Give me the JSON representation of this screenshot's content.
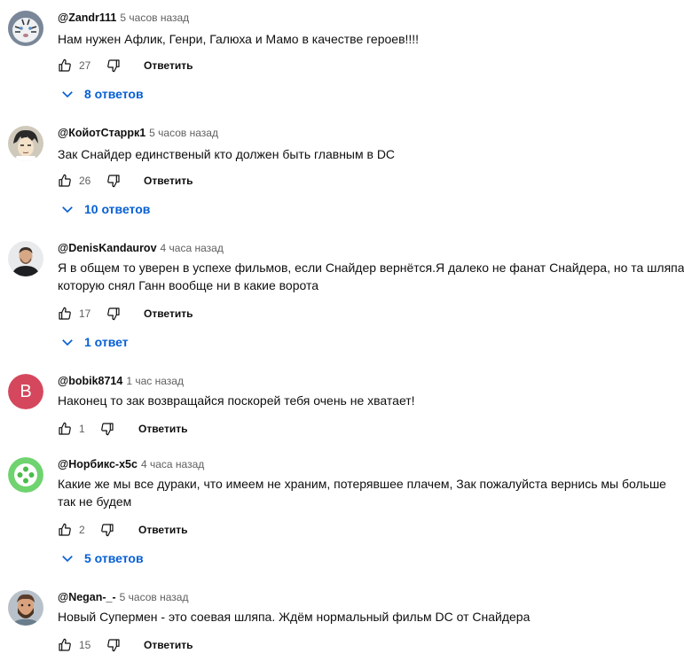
{
  "comments": [
    {
      "author": "@Zandr111",
      "time": "5 часов назад",
      "text_lines": [
        "Нам нужен Афлик, Генри, Галюха и Мамо в качестве героев!!!!"
      ],
      "likes": "27",
      "reply_label": "Ответить",
      "replies_label": "8 ответов",
      "avatar_icon": "white-tiger-avatar"
    },
    {
      "author": "@КойотСтаррк1",
      "time": "5 часов назад",
      "text_lines": [
        "Зак Снайдер единственый кто должен быть главным в DC"
      ],
      "likes": "26",
      "reply_label": "Ответить",
      "replies_label": "10 ответов",
      "avatar_icon": "anime-character-avatar"
    },
    {
      "author": "@DenisKandaurov",
      "time": "4 часа назад",
      "text_lines": [
        "Я в общем то уверен в успехе фильмов, если Снайдер вернётся.Я далеко не фанат Снайдера, но та шляпа,",
        "которую снял Ганн вообще ни в какие ворота"
      ],
      "likes": "17",
      "reply_label": "Ответить",
      "replies_label": "1 ответ",
      "avatar_icon": "man-photo-avatar"
    },
    {
      "author": "@bobik8714",
      "time": "1 час назад",
      "text_lines": [
        "Наконец то зак возвращайся поскорей тебя очень не хватает!"
      ],
      "likes": "1",
      "reply_label": "Ответить",
      "avatar_letter": "B",
      "avatar_color": "#d5475d"
    },
    {
      "author": "@Норбикс-х5с",
      "time": "4 часа назад",
      "text_lines": [
        "Какие же мы все дураки, что имеем не храним, потерявшее плачем, Зак пожалуйста вернись мы больше",
        "так не будем"
      ],
      "likes": "2",
      "reply_label": "Ответить",
      "replies_label": "5 ответов",
      "avatar_icon": "green-gamepad-avatar"
    },
    {
      "author": "@Negan-_-",
      "time": "5 часов назад",
      "text_lines": [
        "Новый Супермен - это соевая шляпа. Ждём нормальный фильм DC от Снайдера"
      ],
      "likes": "15",
      "reply_label": "Ответить",
      "avatar_icon": "bearded-man-avatar"
    }
  ],
  "colors": {
    "link": "#065fd4",
    "secondary_text": "#606060"
  }
}
